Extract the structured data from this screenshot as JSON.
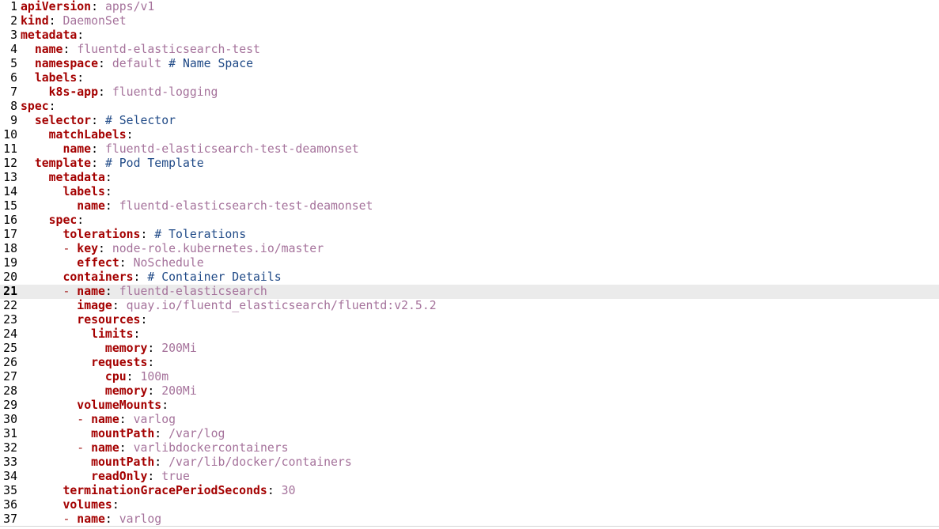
{
  "editor": {
    "current_line": 21,
    "lines": [
      {
        "n": "1",
        "indent": "",
        "dash": "",
        "key": "apiVersion",
        "value": "apps/v1",
        "comment": ""
      },
      {
        "n": "2",
        "indent": "",
        "dash": "",
        "key": "kind",
        "value": "DaemonSet",
        "comment": ""
      },
      {
        "n": "3",
        "indent": "",
        "dash": "",
        "key": "metadata",
        "value": "",
        "comment": ""
      },
      {
        "n": "4",
        "indent": "  ",
        "dash": "",
        "key": "name",
        "value": "fluentd-elasticsearch-test",
        "comment": ""
      },
      {
        "n": "5",
        "indent": "  ",
        "dash": "",
        "key": "namespace",
        "value": "default",
        "comment": "# Name Space"
      },
      {
        "n": "6",
        "indent": "  ",
        "dash": "",
        "key": "labels",
        "value": "",
        "comment": ""
      },
      {
        "n": "7",
        "indent": "    ",
        "dash": "",
        "key": "k8s-app",
        "value": "fluentd-logging",
        "comment": ""
      },
      {
        "n": "8",
        "indent": "",
        "dash": "",
        "key": "spec",
        "value": "",
        "comment": ""
      },
      {
        "n": "9",
        "indent": "  ",
        "dash": "",
        "key": "selector",
        "value": "",
        "comment": "# Selector"
      },
      {
        "n": "10",
        "indent": "    ",
        "dash": "",
        "key": "matchLabels",
        "value": "",
        "comment": ""
      },
      {
        "n": "11",
        "indent": "      ",
        "dash": "",
        "key": "name",
        "value": "fluentd-elasticsearch-test-deamonset",
        "comment": ""
      },
      {
        "n": "12",
        "indent": "  ",
        "dash": "",
        "key": "template",
        "value": "",
        "comment": "# Pod Template"
      },
      {
        "n": "13",
        "indent": "    ",
        "dash": "",
        "key": "metadata",
        "value": "",
        "comment": ""
      },
      {
        "n": "14",
        "indent": "      ",
        "dash": "",
        "key": "labels",
        "value": "",
        "comment": ""
      },
      {
        "n": "15",
        "indent": "        ",
        "dash": "",
        "key": "name",
        "value": "fluentd-elasticsearch-test-deamonset",
        "comment": ""
      },
      {
        "n": "16",
        "indent": "    ",
        "dash": "",
        "key": "spec",
        "value": "",
        "comment": ""
      },
      {
        "n": "17",
        "indent": "      ",
        "dash": "",
        "key": "tolerations",
        "value": "",
        "comment": "# Tolerations"
      },
      {
        "n": "18",
        "indent": "      ",
        "dash": "- ",
        "key": "key",
        "value": "node-role.kubernetes.io/master",
        "comment": ""
      },
      {
        "n": "19",
        "indent": "        ",
        "dash": "",
        "key": "effect",
        "value": "NoSchedule",
        "comment": ""
      },
      {
        "n": "20",
        "indent": "      ",
        "dash": "",
        "key": "containers",
        "value": "",
        "comment": "# Container Details"
      },
      {
        "n": "21",
        "indent": "      ",
        "dash": "- ",
        "key": "name",
        "value": "fluentd-elasticsearch",
        "comment": ""
      },
      {
        "n": "22",
        "indent": "        ",
        "dash": "",
        "key": "image",
        "value": "quay.io/fluentd_elasticsearch/fluentd:v2.5.2",
        "comment": ""
      },
      {
        "n": "23",
        "indent": "        ",
        "dash": "",
        "key": "resources",
        "value": "",
        "comment": ""
      },
      {
        "n": "24",
        "indent": "          ",
        "dash": "",
        "key": "limits",
        "value": "",
        "comment": ""
      },
      {
        "n": "25",
        "indent": "            ",
        "dash": "",
        "key": "memory",
        "value": "200Mi",
        "comment": ""
      },
      {
        "n": "26",
        "indent": "          ",
        "dash": "",
        "key": "requests",
        "value": "",
        "comment": ""
      },
      {
        "n": "27",
        "indent": "            ",
        "dash": "",
        "key": "cpu",
        "value": "100m",
        "comment": ""
      },
      {
        "n": "28",
        "indent": "            ",
        "dash": "",
        "key": "memory",
        "value": "200Mi",
        "comment": ""
      },
      {
        "n": "29",
        "indent": "        ",
        "dash": "",
        "key": "volumeMounts",
        "value": "",
        "comment": ""
      },
      {
        "n": "30",
        "indent": "        ",
        "dash": "- ",
        "key": "name",
        "value": "varlog",
        "comment": ""
      },
      {
        "n": "31",
        "indent": "          ",
        "dash": "",
        "key": "mountPath",
        "value": "/var/log",
        "comment": ""
      },
      {
        "n": "32",
        "indent": "        ",
        "dash": "- ",
        "key": "name",
        "value": "varlibdockercontainers",
        "comment": ""
      },
      {
        "n": "33",
        "indent": "          ",
        "dash": "",
        "key": "mountPath",
        "value": "/var/lib/docker/containers",
        "comment": ""
      },
      {
        "n": "34",
        "indent": "          ",
        "dash": "",
        "key": "readOnly",
        "value": "true",
        "comment": ""
      },
      {
        "n": "35",
        "indent": "      ",
        "dash": "",
        "key": "terminationGracePeriodSeconds",
        "value": "30",
        "comment": ""
      },
      {
        "n": "36",
        "indent": "      ",
        "dash": "",
        "key": "volumes",
        "value": "",
        "comment": ""
      },
      {
        "n": "37",
        "indent": "      ",
        "dash": "- ",
        "key": "name",
        "value": "varlog",
        "comment": ""
      }
    ]
  }
}
